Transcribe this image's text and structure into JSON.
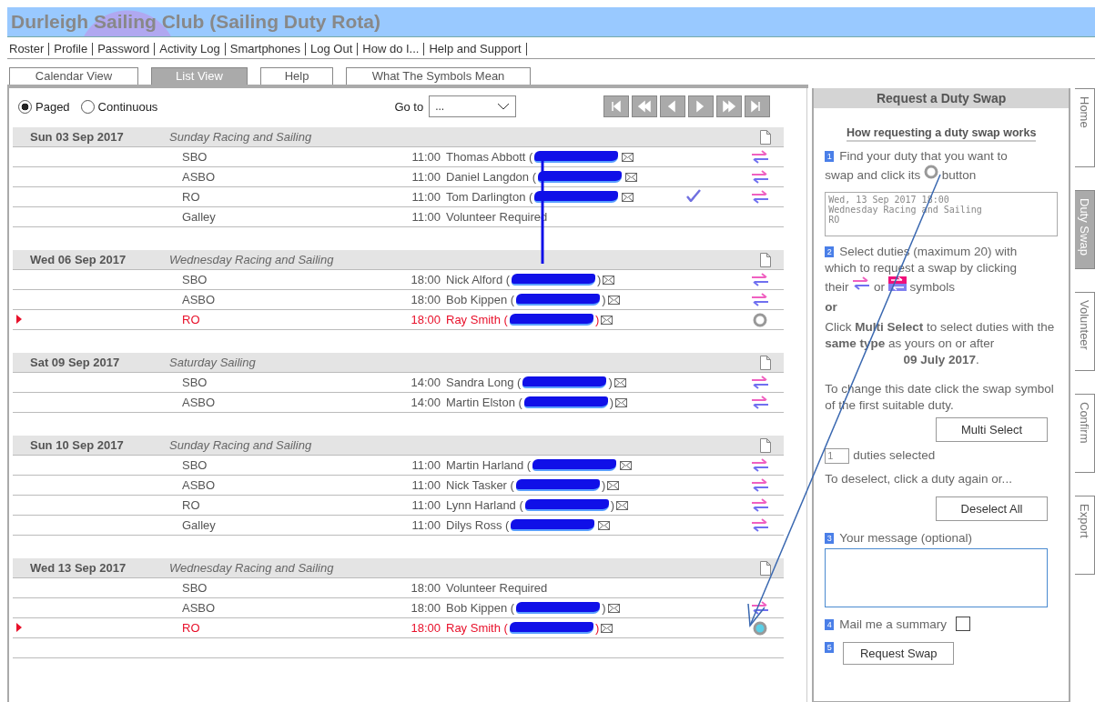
{
  "header": {
    "title": "Durleigh Sailing Club (Sailing Duty Rota)"
  },
  "nav": [
    "Roster",
    "Profile",
    "Password",
    "Activity Log",
    "Smartphones",
    "Log Out",
    "How do I...",
    "Help and Support"
  ],
  "tabs": [
    {
      "label": "Calendar View",
      "selected": false
    },
    {
      "label": "List View",
      "selected": true
    },
    {
      "label": "Help",
      "selected": false
    },
    {
      "label": "What The Symbols Mean",
      "selected": false
    }
  ],
  "view_modes": [
    {
      "label": "Paged",
      "selected": true
    },
    {
      "label": "Continuous",
      "selected": false
    }
  ],
  "goto": {
    "label": "Go to",
    "value": "..."
  },
  "days": [
    {
      "date": "Sun 03 Sep 2017",
      "event": "Sunday Racing and Sailing",
      "duties": [
        {
          "role": "SBO",
          "time": "11:00",
          "person": "Thomas Abbott (",
          "kind": "swap",
          "mine": false,
          "confirmed": false
        },
        {
          "role": "ASBO",
          "time": "11:00",
          "person": "Daniel Langdon (",
          "kind": "swap",
          "mine": false,
          "confirmed": false
        },
        {
          "role": "RO",
          "time": "11:00",
          "person": "Tom Darlington (",
          "kind": "swap",
          "mine": false,
          "confirmed": true
        },
        {
          "role": "Galley",
          "time": "11:00",
          "person": "Volunteer Required",
          "kind": "vacant",
          "mine": false,
          "confirmed": false
        }
      ]
    },
    {
      "date": "Wed 06 Sep 2017",
      "event": "Wednesday Racing and Sailing",
      "duties": [
        {
          "role": "SBO",
          "time": "18:00",
          "person": "Nick Alford (",
          "close": ")",
          "kind": "swap",
          "mine": false,
          "confirmed": false
        },
        {
          "role": "ASBO",
          "time": "18:00",
          "person": "Bob Kippen (",
          "close": ")",
          "kind": "swap",
          "mine": false,
          "confirmed": false
        },
        {
          "role": "RO",
          "time": "18:00",
          "person": "Ray Smith (",
          "close": ")",
          "kind": "pick",
          "mine": true,
          "confirmed": false
        }
      ]
    },
    {
      "date": "Sat 09 Sep 2017",
      "event": "Saturday Sailing",
      "duties": [
        {
          "role": "SBO",
          "time": "14:00",
          "person": "Sandra Long (",
          "close": ")",
          "kind": "swap",
          "mine": false,
          "confirmed": false
        },
        {
          "role": "ASBO",
          "time": "14:00",
          "person": "Martin Elston (",
          "close": ")",
          "kind": "swap",
          "mine": false,
          "confirmed": false
        }
      ]
    },
    {
      "date": "Sun 10 Sep 2017",
      "event": "Sunday Racing and Sailing",
      "duties": [
        {
          "role": "SBO",
          "time": "11:00",
          "person": "Martin Harland (",
          "kind": "swap",
          "mine": false,
          "confirmed": false
        },
        {
          "role": "ASBO",
          "time": "11:00",
          "person": "Nick Tasker (",
          "close": ")",
          "kind": "swap",
          "mine": false,
          "confirmed": false
        },
        {
          "role": "RO",
          "time": "11:00",
          "person": "Lynn Harland (",
          "close": ")",
          "kind": "swap",
          "mine": false,
          "confirmed": false
        },
        {
          "role": "Galley",
          "time": "11:00",
          "person": "Dilys Ross (",
          "kind": "swap",
          "mine": false,
          "confirmed": false
        }
      ]
    },
    {
      "date": "Wed 13 Sep 2017",
      "event": "Wednesday Racing and Sailing",
      "duties": [
        {
          "role": "SBO",
          "time": "18:00",
          "person": "Volunteer Required",
          "kind": "vacant",
          "mine": false,
          "confirmed": false
        },
        {
          "role": "ASBO",
          "time": "18:00",
          "person": "Bob Kippen (",
          "close": ")",
          "kind": "swap",
          "mine": false,
          "confirmed": false
        },
        {
          "role": "RO",
          "time": "18:00",
          "person": "Ray Smith (",
          "close": ")",
          "kind": "picked",
          "mine": true,
          "confirmed": false
        }
      ]
    }
  ],
  "swap_panel": {
    "title": "Request a Duty Swap",
    "how": "How requesting a duty swap works",
    "step1": {
      "number": "1",
      "line1": "Find your duty that you want to",
      "before": "swap and click its",
      "after": "button"
    },
    "selected_duty": [
      "Wed, 13 Sep 2017 18:00",
      "Wednesday Racing and Sailing",
      "RO"
    ],
    "step2": {
      "number": "2",
      "line1": "Select duties (maximum 20) with",
      "line2": "which to request a swap by clicking",
      "before": "their",
      "middle": "or",
      "after": "symbols"
    },
    "or": "or",
    "multi_text": "Click **Multi Select** to select duties with the **same type** as yours on or after",
    "multi_date": "**09 July 2017**.",
    "change_text": "To change this date click the swap symbol of the first suitable duty.",
    "multi_button": "Multi Select",
    "count": "1",
    "count_label": "duties selected",
    "deselect_text": "To deselect, click a duty again or...",
    "deselect_button": "Deselect All",
    "step3": {
      "number": "3",
      "label": "Your message (optional)"
    },
    "step4": {
      "number": "4",
      "label": "Mail me a summary",
      "checked": false
    },
    "step5": {
      "number": "5",
      "button": "Request Swap"
    }
  },
  "side_tabs": [
    {
      "label": "Home",
      "selected": false
    },
    {
      "label": "Duty Swap",
      "selected": true
    },
    {
      "label": "Volunteer",
      "selected": false
    },
    {
      "label": "Confirm",
      "selected": false
    },
    {
      "label": "Export",
      "selected": false
    }
  ]
}
